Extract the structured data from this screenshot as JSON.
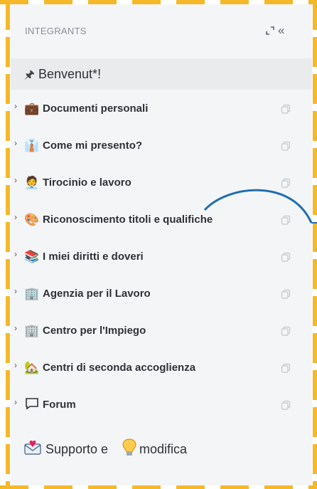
{
  "sidebar": {
    "title": "INTEGRANTS",
    "collapse_glyph": "«",
    "welcome": {
      "pin_glyph": "🖈",
      "label": "Benvenut*!"
    },
    "items": [
      {
        "label": "Documenti personali",
        "emoji": "💼",
        "icon": "briefcase-icon"
      },
      {
        "label": "Come mi presento?",
        "emoji": "👔",
        "icon": "necktie-icon"
      },
      {
        "label": "Tirocinio e lavoro",
        "emoji": "🧑‍💼",
        "icon": "office-worker-icon"
      },
      {
        "label": "Riconoscimento titoli e qualifiche",
        "emoji": "🎨",
        "icon": "palette-icon"
      },
      {
        "label": "I miei diritti e doveri",
        "emoji": "📚",
        "icon": "books-icon"
      },
      {
        "label": "Agenzia per il Lavoro",
        "emoji": "🏢",
        "icon": "office-building-icon"
      },
      {
        "label": "Centro per l'Impiego",
        "emoji": "🏢",
        "icon": "office-building-icon"
      },
      {
        "label": "Centri di seconda accoglienza",
        "emoji": "🏡",
        "icon": "house-garden-icon"
      },
      {
        "label": "Forum",
        "emoji": "",
        "icon": "speech-bubble-icon"
      }
    ],
    "support": {
      "label_part1": "Supporto e",
      "label_part2": "modifica"
    }
  },
  "colors": {
    "frame": "#F5B829",
    "sidebar_bg": "#F4F5F6",
    "selected_bg": "#EAEBED",
    "curve": "#1F6FB0"
  }
}
